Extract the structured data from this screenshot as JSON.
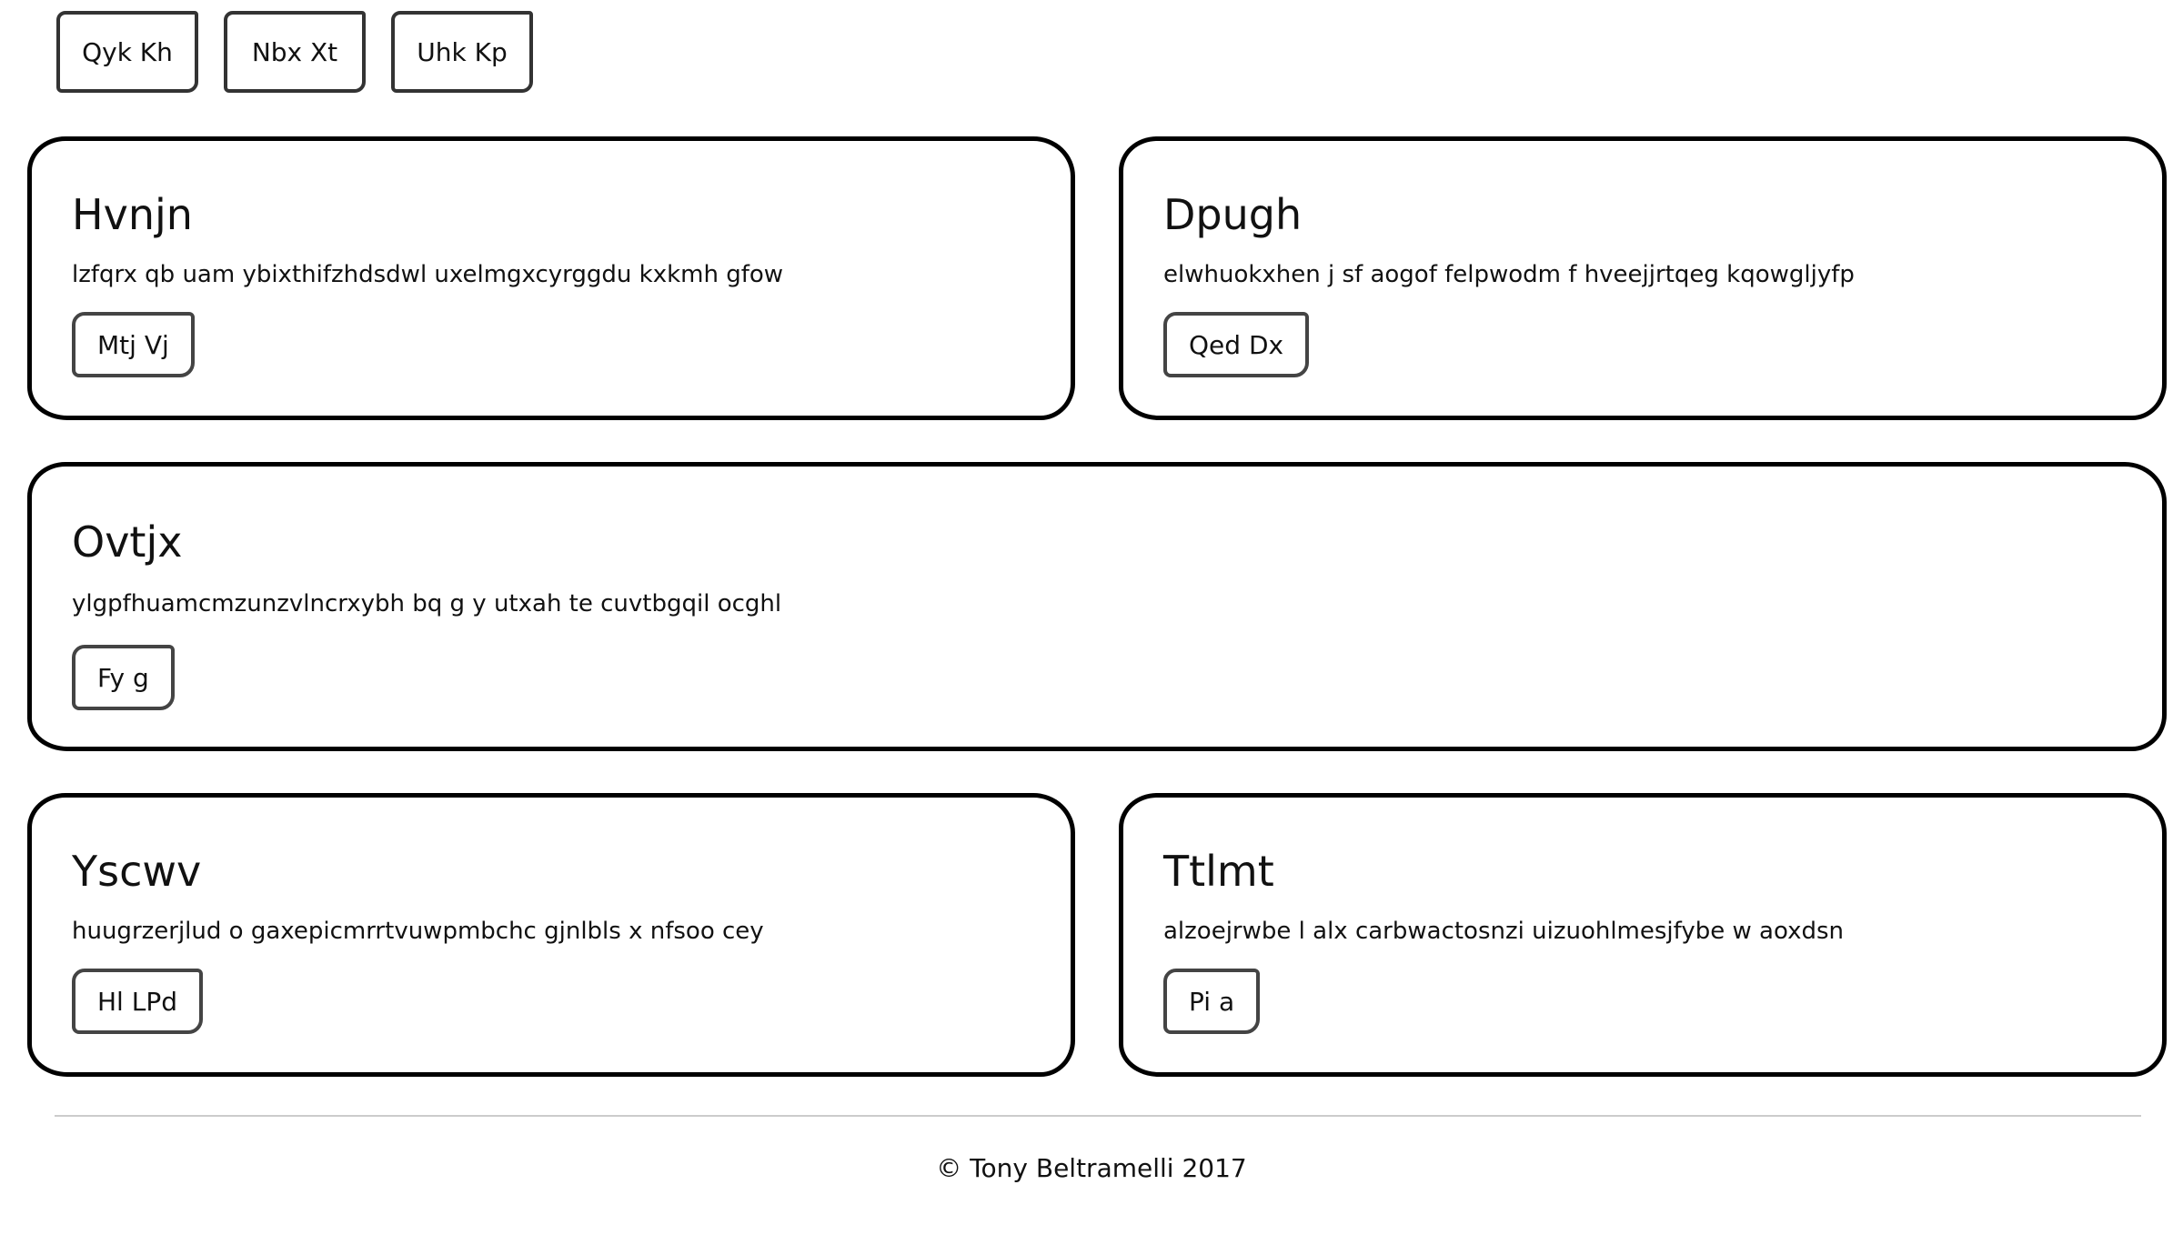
{
  "nav": {
    "buttons": [
      {
        "label": "Qyk Kh"
      },
      {
        "label": "Nbx Xt"
      },
      {
        "label": "Uhk Kp"
      }
    ]
  },
  "cards": [
    {
      "title": "Hvnjn",
      "text": "lzfqrx qb uam ybixthifzhdsdwl uxelmgxcyrggdu kxkmh gfow",
      "button": "Mtj Vj"
    },
    {
      "title": "Dpugh",
      "text": "elwhuokxhen j sf aogof felpwodm f hveejjrtqeg kqowgljyfp",
      "button": "Qed Dx"
    },
    {
      "title": "Ovtjx",
      "text": "ylgpfhuamcmzunzvlncrxybh bq g y utxah te cuvtbgqil ocghl",
      "button": "Fy g"
    },
    {
      "title": "Yscwv",
      "text": "huugrzerjlud o gaxepicmrrtvuwpmbchc gjnlbls x nfsoo cey",
      "button": "Hl LPd"
    },
    {
      "title": "Ttlmt",
      "text": "alzoejrwbe l alx carbwactosnzi uizuohlmesjfybe w aoxdsn",
      "button": "Pi a"
    }
  ],
  "footer": {
    "text": "© Tony Beltramelli 2017"
  }
}
